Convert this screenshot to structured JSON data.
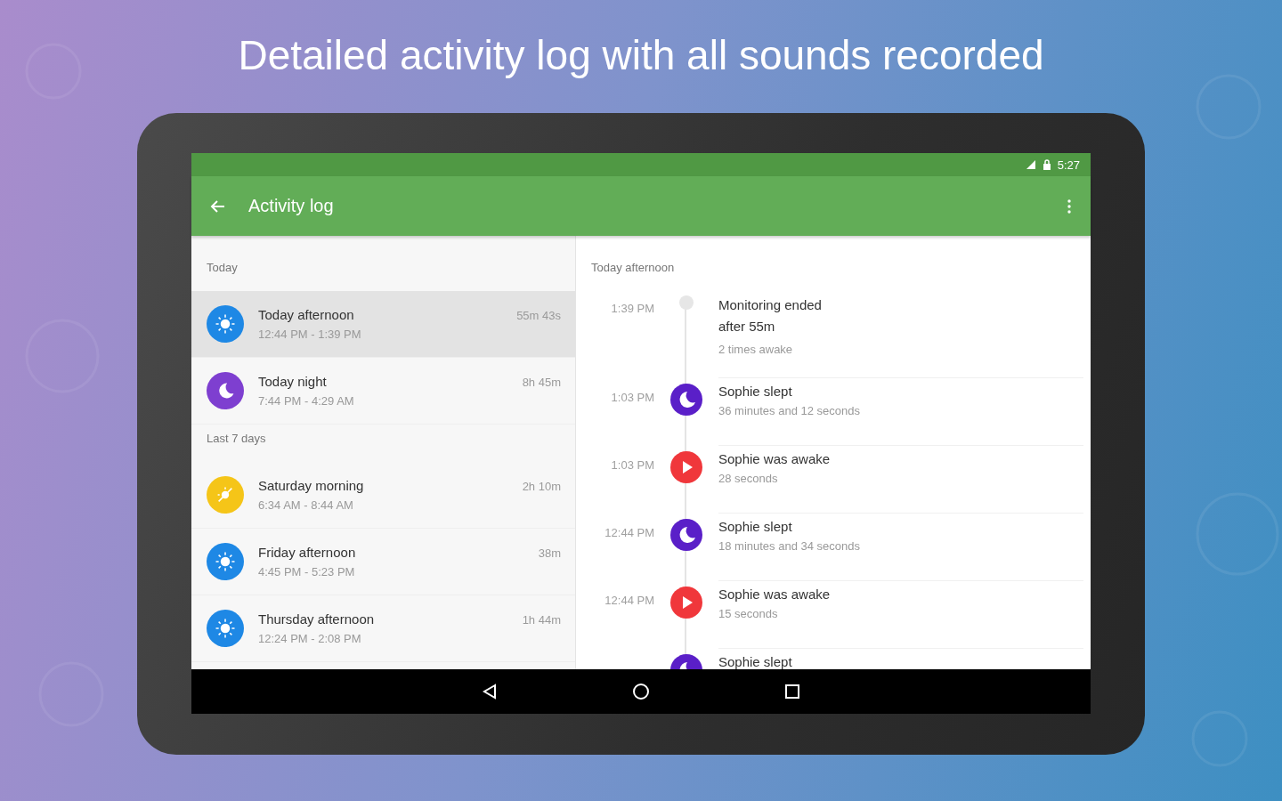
{
  "headline": "Detailed activity log with all sounds recorded",
  "status_bar": {
    "time": "5:27"
  },
  "app_bar": {
    "title": "Activity log"
  },
  "sessions": [
    {
      "section": "Today",
      "items": [
        {
          "kind": "day",
          "color": "#1e88e5",
          "title": "Today afternoon",
          "range": "12:44 PM - 1:39 PM",
          "duration": "55m 43s",
          "selected": true
        },
        {
          "kind": "night",
          "color": "#7e3fd0",
          "title": "Today night",
          "range": "7:44 PM - 4:29 AM",
          "duration": "8h 45m",
          "selected": false
        }
      ]
    },
    {
      "section": "Last 7 days",
      "items": [
        {
          "kind": "morning",
          "color": "#f5c518",
          "title": "Saturday morning",
          "range": "6:34 AM - 8:44 AM",
          "duration": "2h 10m",
          "selected": false
        },
        {
          "kind": "day",
          "color": "#1e88e5",
          "title": "Friday afternoon",
          "range": "4:45 PM - 5:23 PM",
          "duration": "38m",
          "selected": false
        },
        {
          "kind": "day",
          "color": "#1e88e5",
          "title": "Thursday afternoon",
          "range": "12:24 PM - 2:08 PM",
          "duration": "1h 44m",
          "selected": false
        }
      ]
    }
  ],
  "timeline": {
    "heading": "Today afternoon",
    "events": [
      {
        "kind": "end",
        "time": "1:39 PM",
        "title": "Monitoring ended after 55m",
        "detail": "2 times awake"
      },
      {
        "kind": "sleep",
        "time": "1:03 PM",
        "title": "Sophie slept",
        "detail": "36 minutes and 12 seconds"
      },
      {
        "kind": "awake",
        "time": "1:03 PM",
        "title": "Sophie was awake",
        "detail": "28 seconds"
      },
      {
        "kind": "sleep",
        "time": "12:44 PM",
        "title": "Sophie slept",
        "detail": "18 minutes and 34 seconds"
      },
      {
        "kind": "awake",
        "time": "12:44 PM",
        "title": "Sophie was awake",
        "detail": "15 seconds"
      },
      {
        "kind": "sleep",
        "title": "Sophie slept"
      }
    ]
  }
}
